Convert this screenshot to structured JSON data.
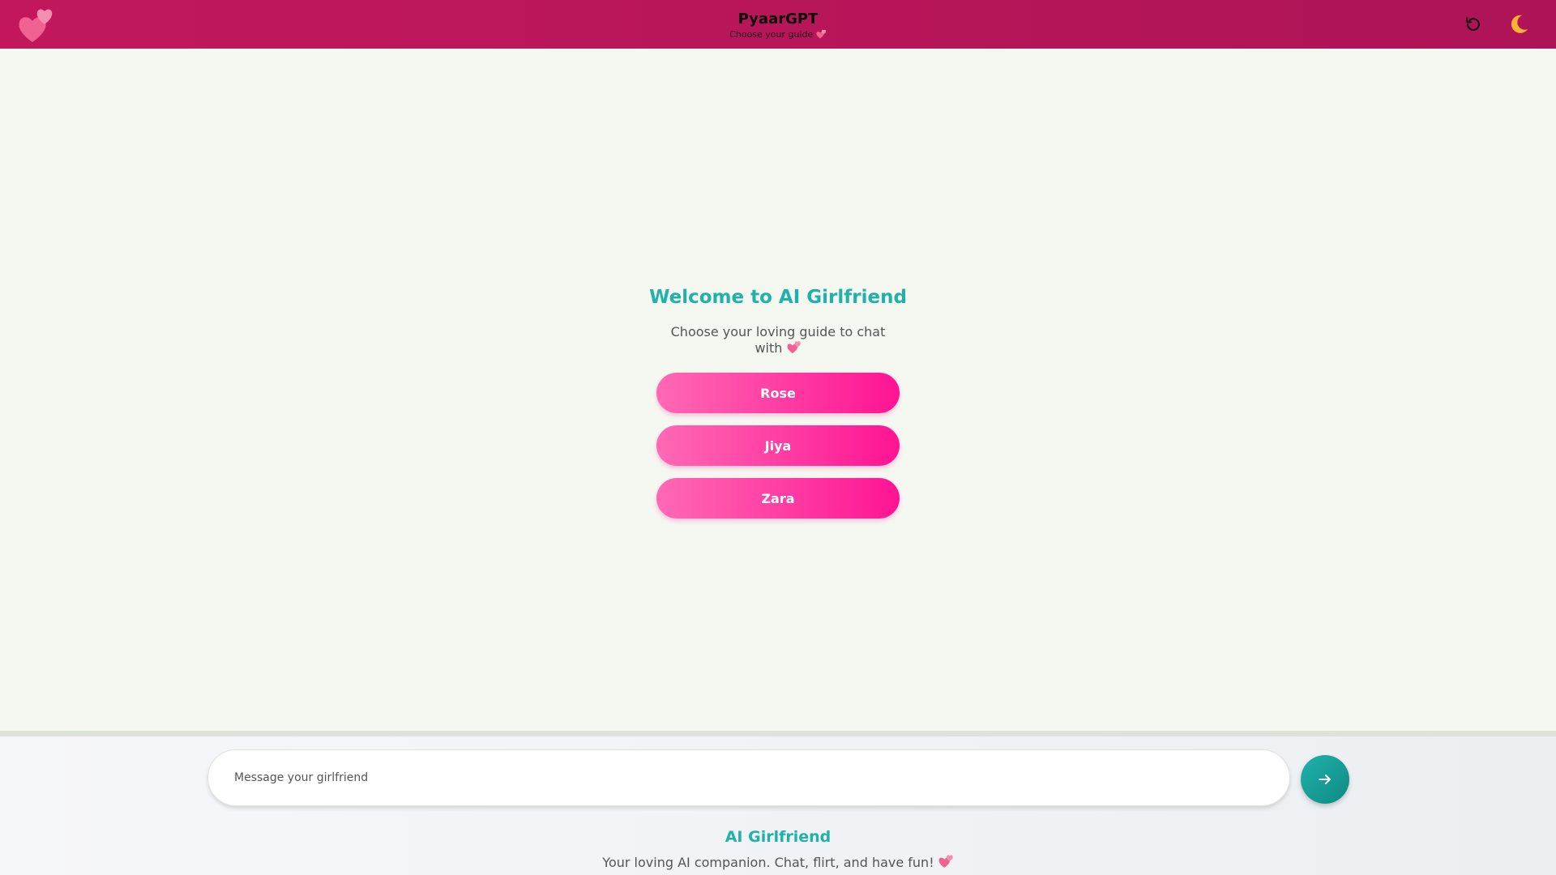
{
  "header": {
    "logo_icon": "two-hearts-icon",
    "title": "PyaarGPT",
    "subtitle": "Choose your guide",
    "subtitle_icon": "two-hearts-icon",
    "reset_icon": "refresh-icon",
    "theme_icon": "crescent-moon-icon"
  },
  "welcome": {
    "title": "Welcome to AI Girlfriend",
    "subtitle": "Choose your loving guide to chat with",
    "subtitle_icon": "two-hearts-icon",
    "guides": [
      {
        "label": "Rose"
      },
      {
        "label": "Jiya"
      },
      {
        "label": "Zara"
      }
    ]
  },
  "composer": {
    "placeholder": "Message your girlfriend",
    "send_icon": "arrow-right-icon"
  },
  "footer": {
    "title": "AI Girlfriend",
    "tagline": "Your loving AI companion. Chat, flirt, and have fun!",
    "tagline_icon": "two-hearts-icon"
  },
  "colors": {
    "header_start": "#c2185b",
    "header_end": "#ad1457",
    "accent_teal": "#20b2aa",
    "guide_pink_start": "#ff69b4",
    "guide_pink_end": "#ff1493",
    "background": "#f5f8f1"
  }
}
